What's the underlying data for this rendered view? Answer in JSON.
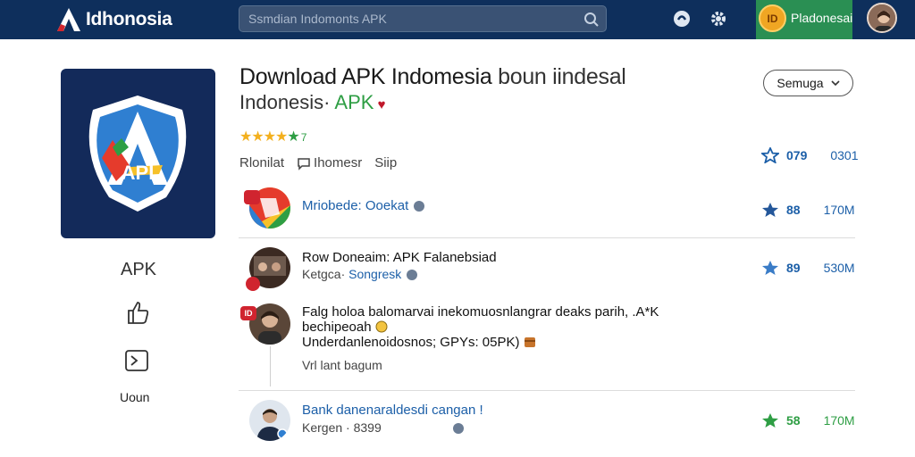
{
  "topbar": {
    "brand": "Idhonosia",
    "search_placeholder": "Ssmdian Indomonts APK",
    "profile_name": "Pladonesai",
    "coin_label": "ID"
  },
  "app": {
    "icon_text": "API",
    "side_label": "APK",
    "side_bottom": "Uoun"
  },
  "header": {
    "title_main": "Download APK Indomesia",
    "title_light": " boun  iindesal",
    "subtitle_main": "Indonesis·",
    "subtitle_apk": " APK",
    "subtitle_heart": " ♥",
    "rating_stars": "★★★★",
    "rating_green_star": "★",
    "rating_value": "7",
    "meta_1": "Rlonilat",
    "meta_2": "Ihomesr",
    "meta_3": "Siip",
    "filter_button": "Semuga"
  },
  "stats": [
    {
      "count": "079",
      "size": "0301"
    },
    {
      "count": "88",
      "size": "170M"
    },
    {
      "count": "89",
      "size": "530M"
    },
    {
      "count": "58",
      "size": "170M"
    }
  ],
  "feed": [
    {
      "title": "Mriobede: Ooekat",
      "subtitle": ""
    },
    {
      "title": "Row Doneaim: APK Falanebsiad",
      "subtitle_prefix": "Ketgca·",
      "subtitle_link": " Songresk"
    },
    {
      "line1": "Falg holoa balomarvai inekomuosnlangrar deaks parih, .A*K",
      "line2": "bechipeoah",
      "line3": "Underdanlenoidosnos; GPYs: 05PK)",
      "line4": "Vrl lant bagum",
      "badge": "ID"
    },
    {
      "title": "Bank danenaraldesdi cangan !",
      "subtitle": "Kergen · 8399"
    }
  ]
}
